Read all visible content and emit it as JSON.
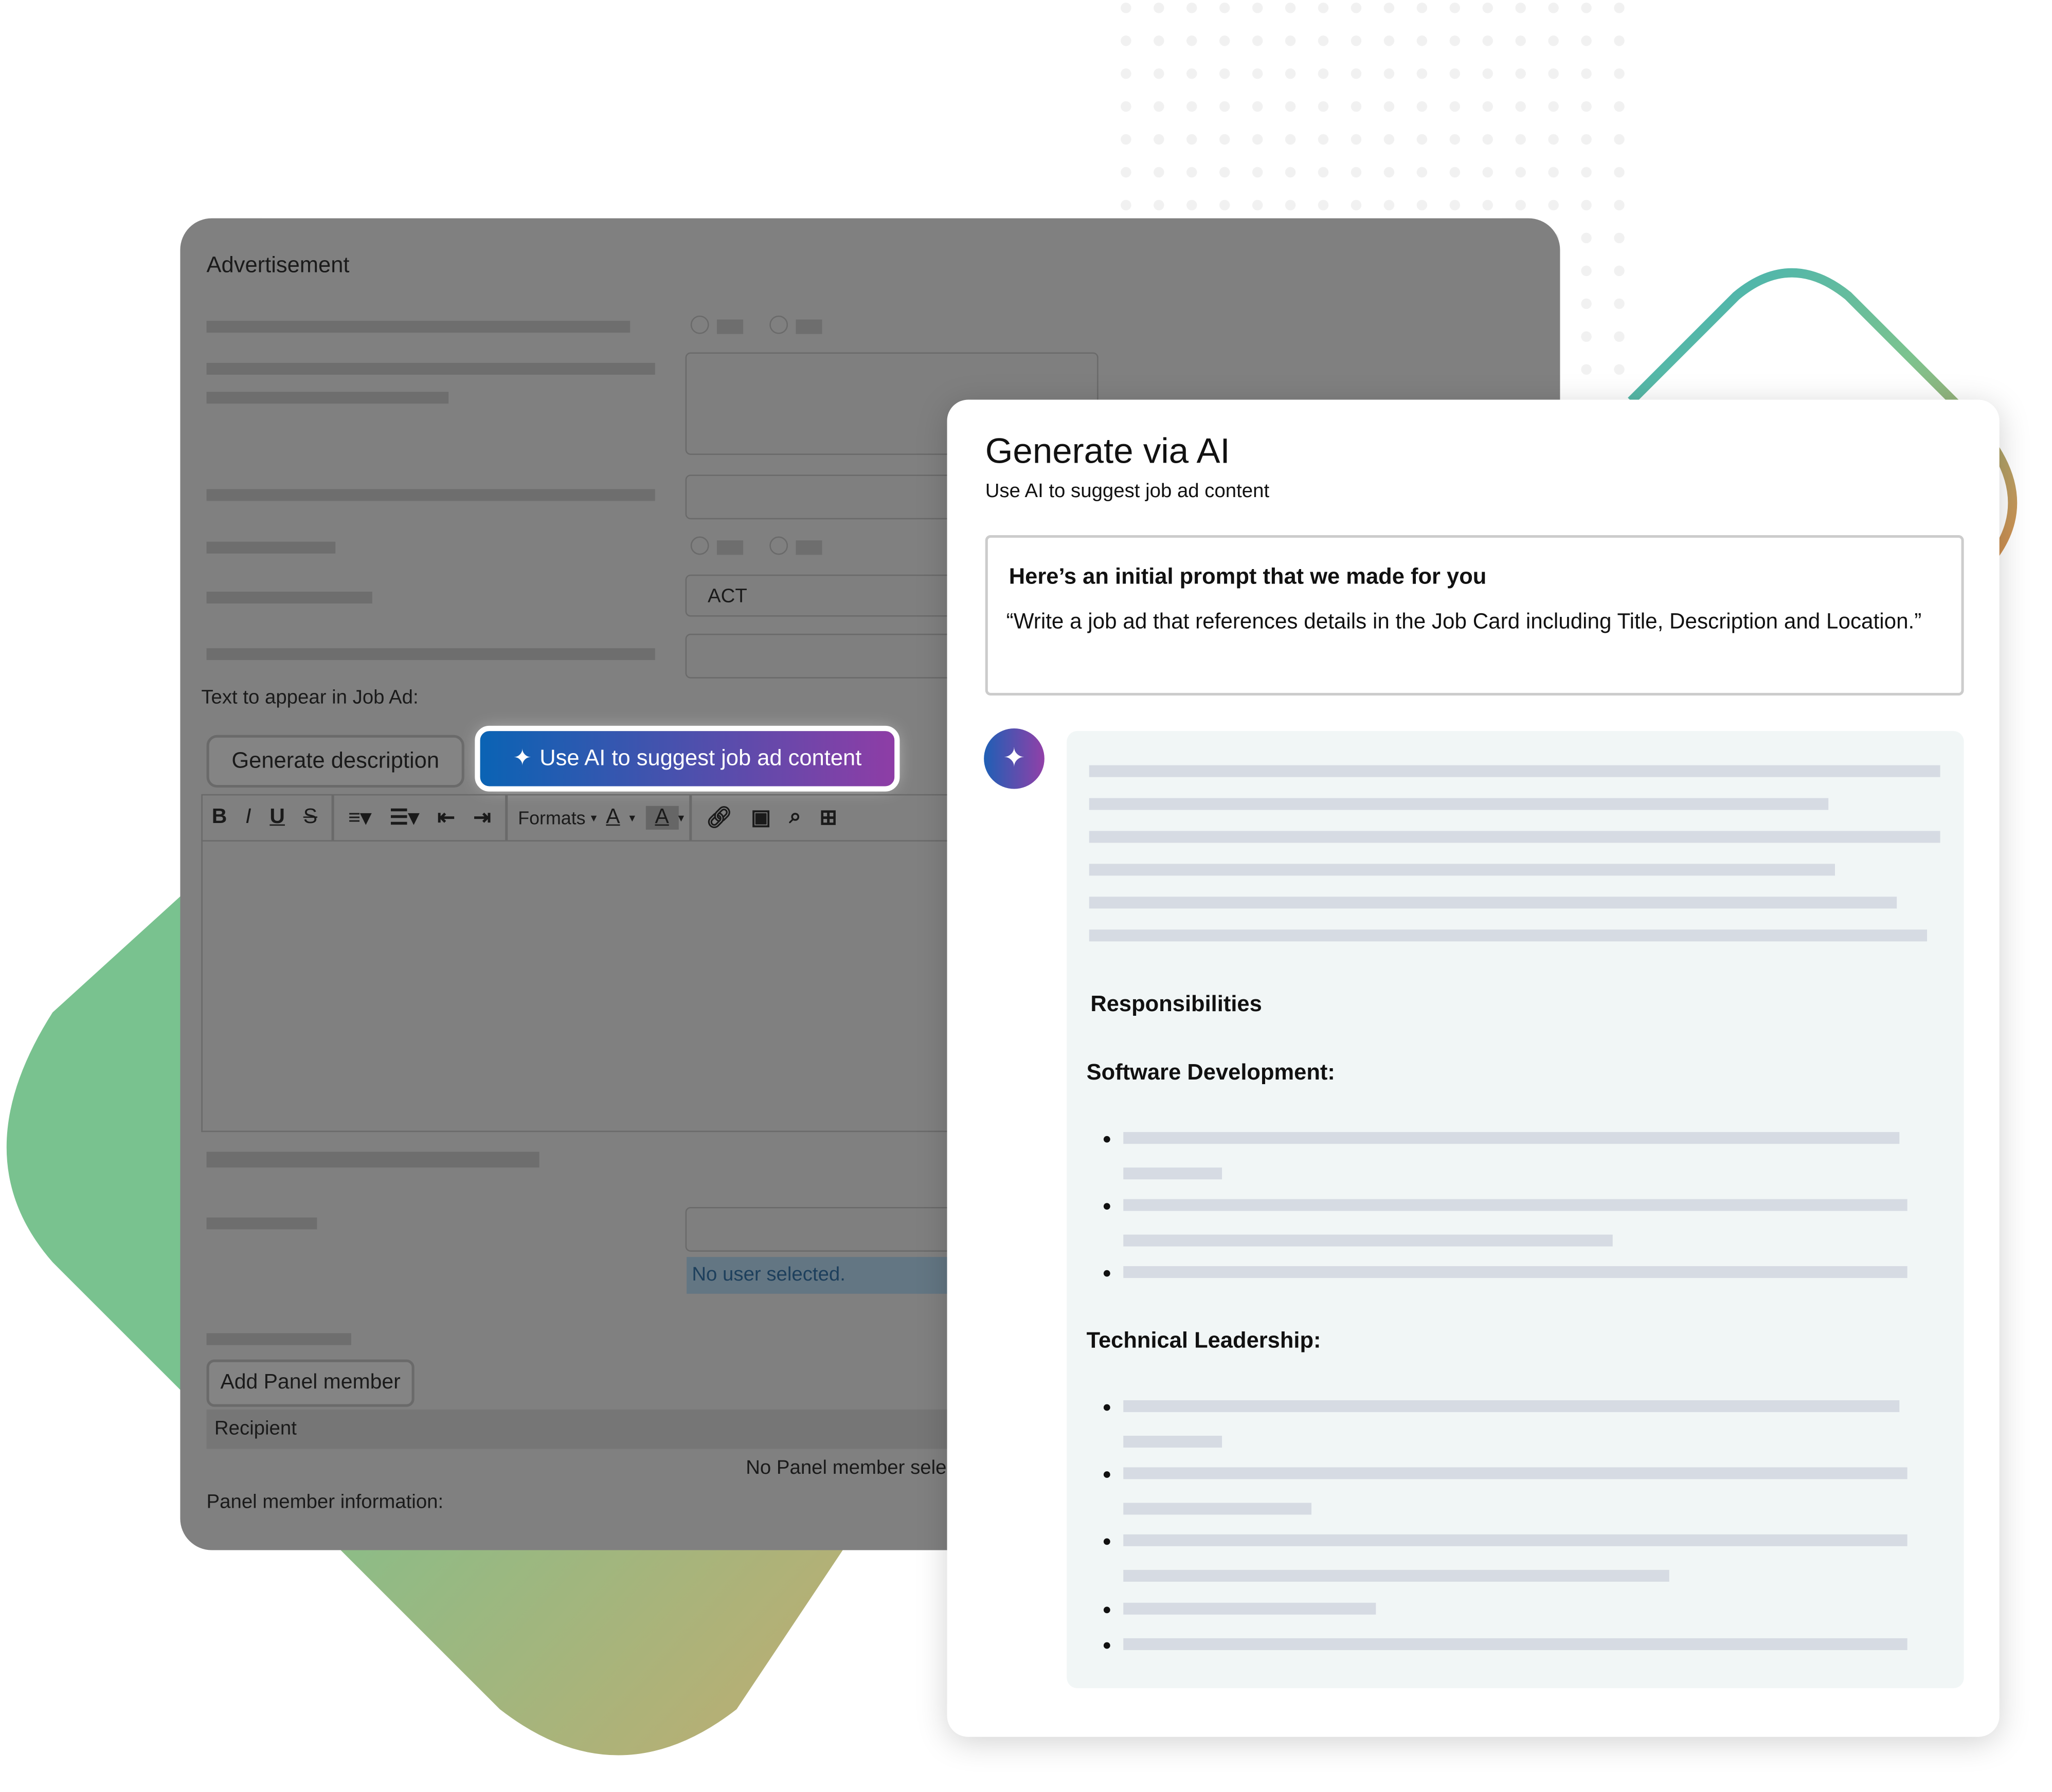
{
  "background": {
    "colors": {
      "green": "#79c28f",
      "orange": "#d9a566",
      "teal": "#3bb0b8"
    }
  },
  "form": {
    "section_title": "Advertisement",
    "state_select_value": "ACT",
    "text_label": "Text to appear in Job Ad:",
    "generate_description_label": "Generate description",
    "ai_button_label": "Use AI to suggest job ad content",
    "toolbar": {
      "bold": "B",
      "italic": "I",
      "underline": "U",
      "strike": "S",
      "formats": "Formats",
      "font_color": "A",
      "bg_color": "A"
    },
    "no_user_selected": "No user selected.",
    "add_panel_member_label": "Add Panel member",
    "recipient_header": "Recipient",
    "no_panel_member": "No Panel member sele",
    "panel_member_info_label": "Panel member information:"
  },
  "modal": {
    "title": "Generate via AI",
    "subtitle": "Use AI to suggest job ad content",
    "prompt_heading": "Here’s an initial prompt that we made for you",
    "prompt_text": "“Write a job ad that references details in the Job Card including Title, Description and Location.”",
    "accent_gradient": [
      "#0a63b4",
      "#8e3da6"
    ],
    "response": {
      "heading_responsibilities": "Responsibilities",
      "heading_software": "Software Development:",
      "heading_leadership": "Technical Leadership:"
    }
  }
}
